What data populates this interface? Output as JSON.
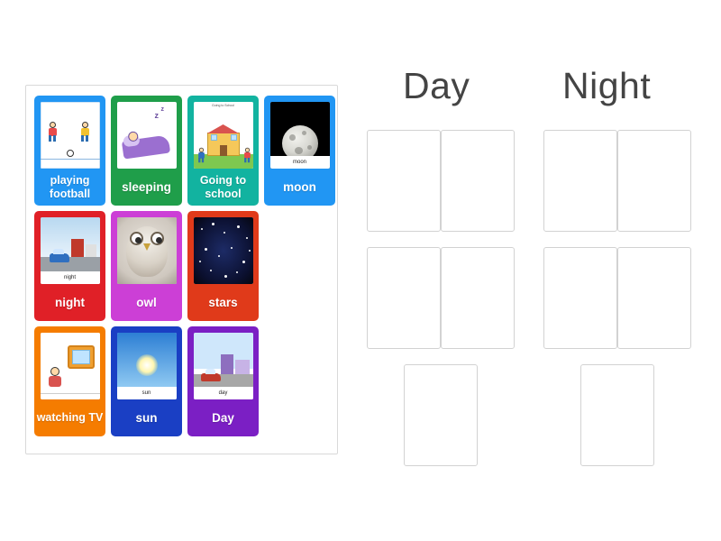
{
  "activity": {
    "type": "group-sort",
    "background": "#ffffff"
  },
  "tray": {
    "name": "card-tray",
    "cards": [
      {
        "label": "playing football",
        "color": "#2196f3",
        "art": "football",
        "small": true
      },
      {
        "label": "sleeping",
        "color": "#1f9e4a",
        "art": "sleeping",
        "small": false
      },
      {
        "label": "Going to school",
        "color": "#12b3a0",
        "art": "school",
        "small": true
      },
      {
        "label": "moon",
        "color": "#2196f3",
        "art": "moon",
        "small": false,
        "inner_word": "moon"
      },
      {
        "label": "night",
        "color": "#e02027",
        "art": "night",
        "small": false,
        "inner_word": "night"
      },
      {
        "label": "owl",
        "color": "#cc3fd6",
        "art": "owl",
        "small": false
      },
      {
        "label": "stars",
        "color": "#e03a1a",
        "art": "stars",
        "small": false
      },
      {
        "label": "watching TV",
        "color": "#f57c00",
        "art": "tv",
        "small": true
      },
      {
        "label": "sun",
        "color": "#1a3fc4",
        "art": "sun",
        "small": false,
        "inner_word": "sun"
      },
      {
        "label": "Day",
        "color": "#7b1fc4",
        "art": "day",
        "small": false,
        "inner_word": "day"
      }
    ]
  },
  "groups": [
    {
      "title": "Day",
      "slot_count": 5
    },
    {
      "title": "Night",
      "slot_count": 5
    }
  ]
}
